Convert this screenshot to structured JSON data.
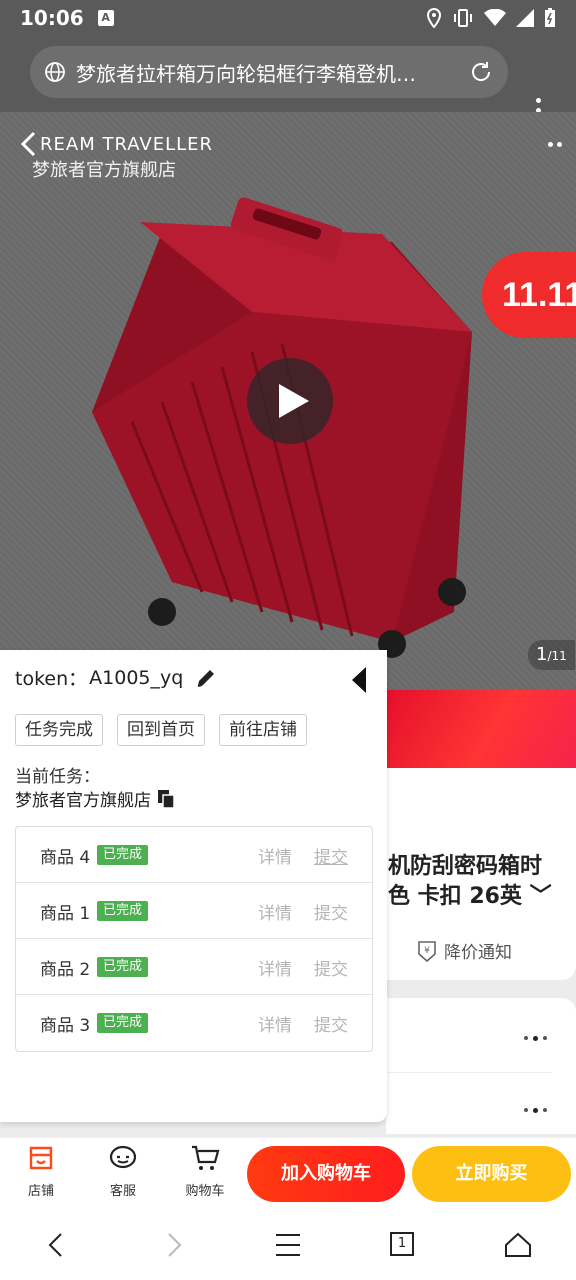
{
  "status_bar": {
    "time": "10:06",
    "badge": "A"
  },
  "browser": {
    "url_text": "梦旅者拉杆箱万向轮铝框行李箱登机…"
  },
  "hero": {
    "brand_en": "REAM TRAVELLER",
    "brand_cn": "梦旅者官方旗舰店",
    "promo_tag": "11.11",
    "page_current": "1",
    "page_total": "/11"
  },
  "product": {
    "title_line1": "机防刮密码箱时",
    "title_line2": "色 卡扣 26英",
    "price_alert": "降价通知"
  },
  "panel": {
    "token_label": "token：",
    "token_value": "A1005_yq",
    "buttons": [
      "任务完成",
      "回到首页",
      "前往店铺"
    ],
    "current_task_label": "当前任务：",
    "current_task_value": "梦旅者官方旗舰店",
    "tasks": [
      {
        "name": "商品 4",
        "status": "已完成",
        "detail": "详情",
        "submit": "提交"
      },
      {
        "name": "商品 1",
        "status": "已完成",
        "detail": "详情",
        "submit": "提交"
      },
      {
        "name": "商品 2",
        "status": "已完成",
        "detail": "详情",
        "submit": "提交"
      },
      {
        "name": "商品 3",
        "status": "已完成",
        "detail": "详情",
        "submit": "提交"
      }
    ]
  },
  "bottom_bar": {
    "shop": "店铺",
    "service": "客服",
    "cart": "购物车",
    "add_cart": "加入购物车",
    "buy_now": "立即购买"
  },
  "sys_nav": {
    "tabs_count": "1"
  },
  "colors": {
    "accent_red": "#ff2a14",
    "buy_yellow": "#fdc012",
    "status_green": "#4caf50",
    "suitcase": "#a3142a"
  }
}
